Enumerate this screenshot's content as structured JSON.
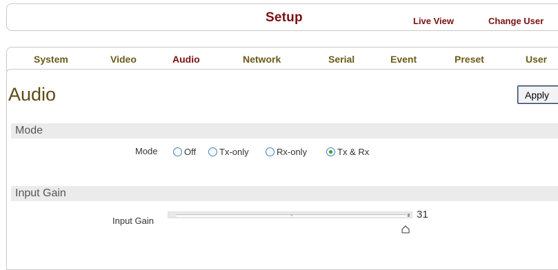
{
  "header": {
    "title": "Setup",
    "live_view": "Live View",
    "change_user": "Change User"
  },
  "tabs": [
    {
      "label": "System"
    },
    {
      "label": "Video"
    },
    {
      "label": "Audio",
      "active": true
    },
    {
      "label": "Network"
    },
    {
      "label": "Serial"
    },
    {
      "label": "Event"
    },
    {
      "label": "Preset"
    },
    {
      "label": "User"
    }
  ],
  "page": {
    "title": "Audio",
    "apply_label": "Apply"
  },
  "mode_section": {
    "heading": "Mode",
    "field_label": "Mode",
    "options": [
      {
        "label": "Off",
        "checked": false
      },
      {
        "label": "Tx-only",
        "checked": false
      },
      {
        "label": "Rx-only",
        "checked": false
      },
      {
        "label": "Tx & Rx",
        "checked": true
      }
    ]
  },
  "gain_section": {
    "heading": "Input Gain",
    "field_label": "Input Gain",
    "value": "31",
    "level_fraction": 1.0
  },
  "colors": {
    "header_link": "#7a1010",
    "tab_text": "#6b5a16",
    "section_bg": "#ebebeb",
    "radio_selected": "#2aa02a"
  }
}
